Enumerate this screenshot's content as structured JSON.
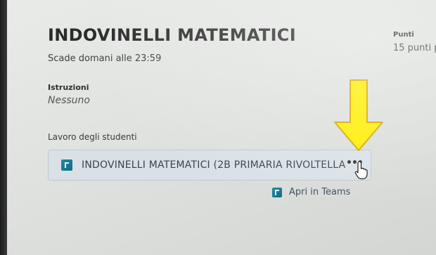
{
  "assignment": {
    "title": "INDOVINELLI MATEMATICI",
    "due": "Scade domani alle 23:59"
  },
  "points": {
    "label": "Punti",
    "value": "15 punti po"
  },
  "instructions": {
    "label": "Istruzioni",
    "value": "Nessuno"
  },
  "student_work": {
    "label": "Lavoro degli studenti",
    "attachment_name": "INDOVINELLI MATEMATICI (2B PRIMARIA RIVOLTELLA",
    "attachment_icon": "forms-icon",
    "more_options": "•••"
  },
  "open_in_teams": {
    "label": "Apri in Teams",
    "icon": "teams-icon"
  },
  "annotation": {
    "arrow_color": "#ffee00",
    "arrow_outline": "#d9a400"
  }
}
